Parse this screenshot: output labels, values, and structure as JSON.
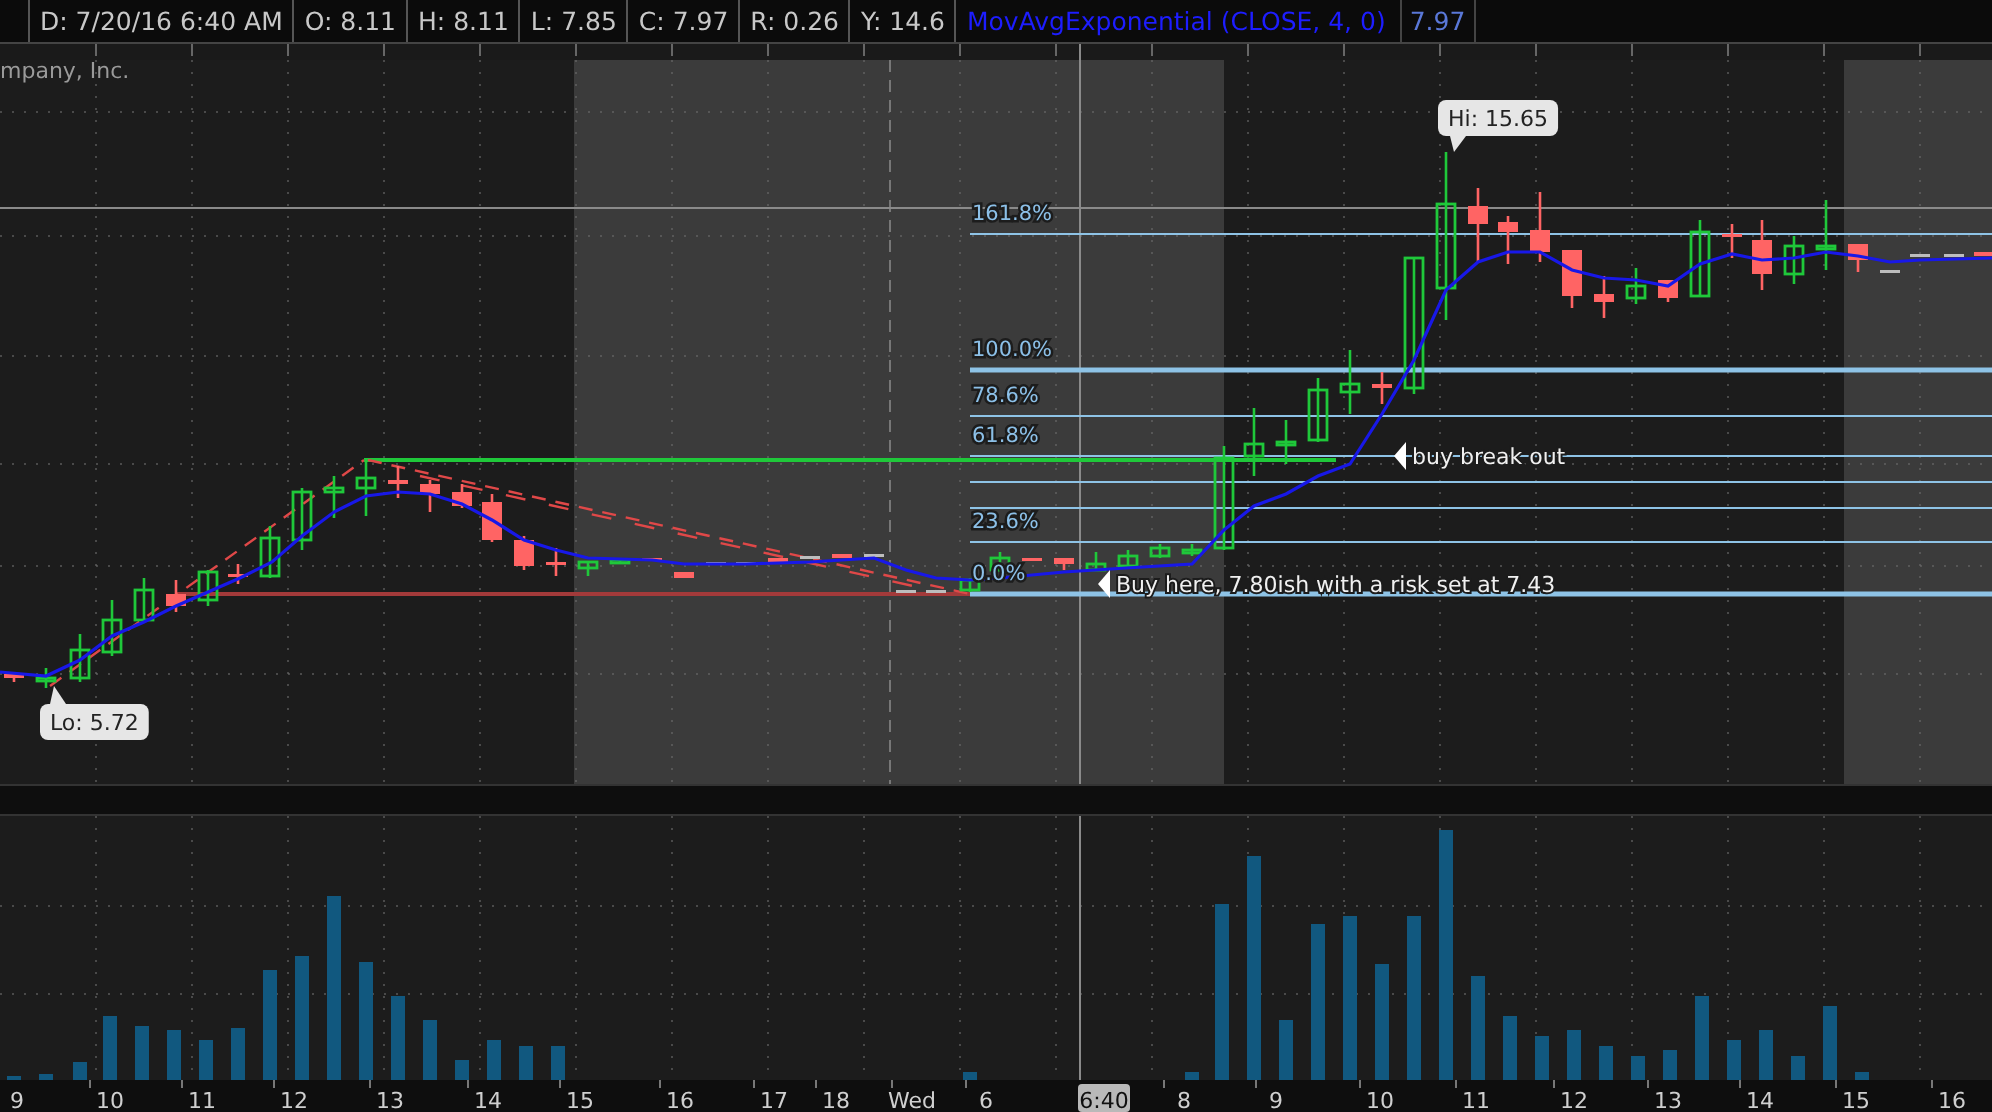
{
  "header": {
    "fields": [
      "D: 7/20/16 6:40 AM",
      "O: 8.11",
      "H: 8.11",
      "L: 7.85",
      "C: 7.97",
      "R: 0.26",
      "Y: 14.6"
    ],
    "study": {
      "name": "MovAvgExponential (CLOSE, 4, 0)",
      "value": "7.97"
    }
  },
  "chart": {
    "symbol_title": "mpany, Inc.",
    "fib_levels": [
      "161.8%",
      "100.0%",
      "78.6%",
      "61.8%",
      "23.6%",
      "0.0%"
    ],
    "annotations": [
      {
        "kind": "bubble",
        "text": "Hi: 15.65"
      },
      {
        "kind": "bubble",
        "text": "Lo: 5.72"
      },
      {
        "kind": "note",
        "text": "buy break out"
      },
      {
        "kind": "note",
        "text": "Buy here, 7.80ish with a risk set at 7.43"
      }
    ]
  },
  "time_axis": [
    {
      "label": "9",
      "kind": "tick"
    },
    {
      "label": "10",
      "kind": "tick"
    },
    {
      "label": "11",
      "kind": "tick"
    },
    {
      "label": "12",
      "kind": "tick"
    },
    {
      "label": "13",
      "kind": "tick"
    },
    {
      "label": "14",
      "kind": "tick"
    },
    {
      "label": "15",
      "kind": "tick"
    },
    {
      "label": "16",
      "kind": "tick"
    },
    {
      "label": "17",
      "kind": "tick"
    },
    {
      "label": "18",
      "kind": "tick"
    },
    {
      "label": "Wed",
      "kind": "tick"
    },
    {
      "label": "6",
      "kind": "tick"
    },
    {
      "label": "6:40",
      "kind": "cursor"
    },
    {
      "label": "8",
      "kind": "tick"
    },
    {
      "label": "9",
      "kind": "tick"
    },
    {
      "label": "10",
      "kind": "tick"
    },
    {
      "label": "11",
      "kind": "tick"
    },
    {
      "label": "12",
      "kind": "tick"
    },
    {
      "label": "13",
      "kind": "tick"
    },
    {
      "label": "14",
      "kind": "tick"
    },
    {
      "label": "15",
      "kind": "tick"
    },
    {
      "label": "16",
      "kind": "tick"
    }
  ]
}
